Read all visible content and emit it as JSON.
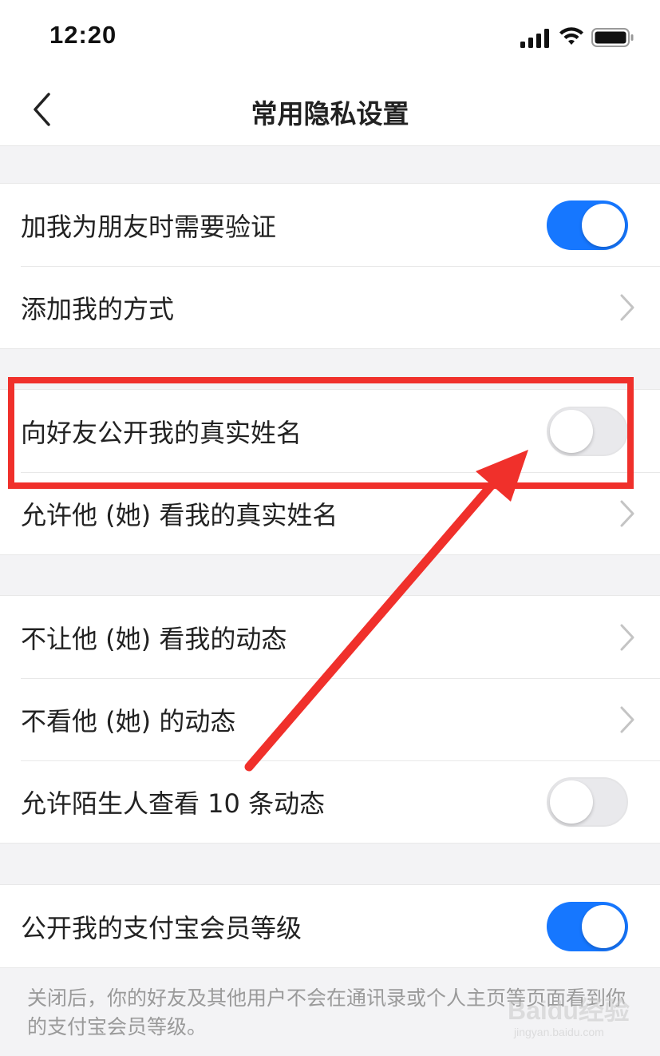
{
  "status_bar": {
    "time": "12:20",
    "icons": [
      "cellular-signal-icon",
      "wifi-icon",
      "battery-icon"
    ]
  },
  "nav": {
    "title": "常用隐私设置",
    "back_icon": "chevron-left-icon"
  },
  "groups": [
    {
      "rows": [
        {
          "label": "加我为朋友时需要验证",
          "control": "toggle",
          "on": true
        },
        {
          "label": "添加我的方式",
          "control": "chevron"
        }
      ]
    },
    {
      "rows": [
        {
          "label": "向好友公开我的真实姓名",
          "control": "toggle",
          "on": false
        },
        {
          "label": "允许他 (她) 看我的真实姓名",
          "control": "chevron"
        }
      ]
    },
    {
      "rows": [
        {
          "label": "不让他 (她) 看我的动态",
          "control": "chevron"
        },
        {
          "label": "不看他 (她) 的动态",
          "control": "chevron"
        },
        {
          "label": "允许陌生人查看 10 条动态",
          "control": "toggle",
          "on": false
        }
      ]
    },
    {
      "rows": [
        {
          "label": "公开我的支付宝会员等级",
          "control": "toggle",
          "on": true
        }
      ]
    }
  ],
  "footnote": "关闭后，你的好友及其他用户不会在通讯录或个人主页等页面看到你的支付宝会员等级。",
  "annotation": {
    "highlight_color": "#f0302b",
    "shapes": [
      "highlight-box",
      "red-arrow"
    ]
  },
  "colors": {
    "accent": "#1677ff",
    "toggle_off": "#e9e9ec",
    "background": "#f3f3f5"
  },
  "watermark": {
    "logo": "Baidu经验",
    "url": "jingyan.baidu.com"
  }
}
